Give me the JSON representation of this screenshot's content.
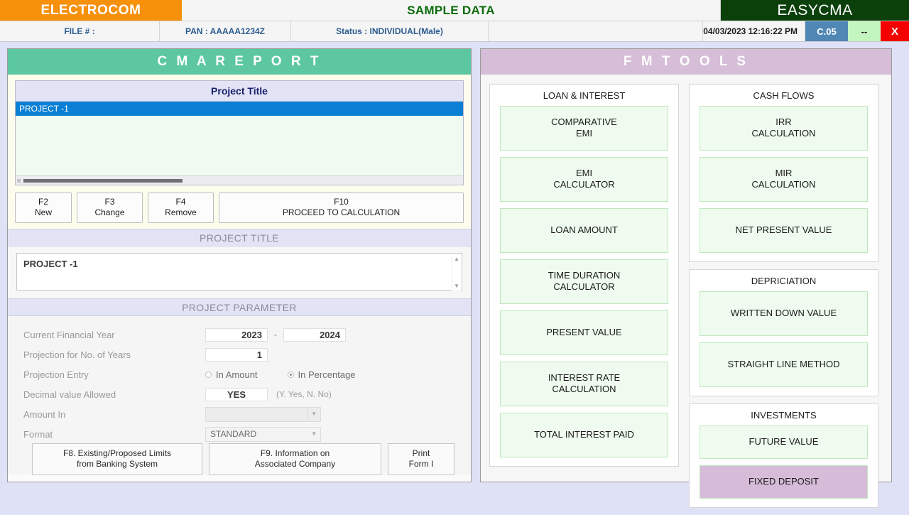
{
  "header": {
    "brand_left": "ELECTROCOM",
    "brand_mid": "SAMPLE DATA",
    "brand_right": "EASYCMA",
    "brand_left_color": "#f7900b",
    "brand_mid_color": "#0b6b0b",
    "brand_right_color": "#0b400b"
  },
  "statusbar": {
    "file": "FILE # :",
    "pan": "PAN : AAAAA1234Z",
    "status": "Status : INDIVIDUAL(Male)",
    "datetime": "04/03/2023 12:16:22 PM",
    "version": "C.05",
    "minimize": "--",
    "close": "X",
    "version_color": "#5087b5",
    "minimize_color": "#c3f5c0",
    "close_color": "#f50000"
  },
  "left_panel": {
    "title": "C M A   R E P O R T",
    "title_bg": "#5cc7a0",
    "list": {
      "column_header": "Project Title",
      "rows": [
        {
          "label": "PROJECT -1",
          "selected": true
        }
      ],
      "selected_bg": "#0a7fd4"
    },
    "fn_buttons": [
      {
        "key": "F2",
        "label": "New"
      },
      {
        "key": "F3",
        "label": "Change"
      },
      {
        "key": "F4",
        "label": "Remove"
      },
      {
        "key": "F10",
        "label": "PROCEED TO CALCULATION"
      }
    ],
    "project_title_band": "PROJECT TITLE",
    "project_title_value": "PROJECT -1",
    "project_parameter_band": "PROJECT PARAMETER",
    "parameters": {
      "financial_year_label": "Current Financial Year",
      "financial_year_from": "2023",
      "financial_year_dash": "-",
      "financial_year_to": "2024",
      "projection_years_label": "Projection for No. of Years",
      "projection_years_value": "1",
      "projection_entry_label": "Projection Entry",
      "projection_entry_option_amount": "In Amount",
      "projection_entry_option_percentage": "In Percentage",
      "projection_entry_selected": "In Percentage",
      "decimal_label": "Decimal value Allowed",
      "decimal_value": "YES",
      "decimal_hint": "(Y. Yes, N. No)",
      "amount_in_label": "Amount In",
      "amount_in_value": "",
      "format_label": "Format",
      "format_value": "STANDARD"
    },
    "bottom_buttons": [
      {
        "line1": "F8. Existing/Proposed Limits",
        "line2": "from Banking System"
      },
      {
        "line1": "F9. Information on",
        "line2": "Associated Company"
      },
      {
        "line1": "Print",
        "line2": "Form I"
      }
    ]
  },
  "right_panel": {
    "title": "F M   T O O L S",
    "title_bg": "#d6bdd8",
    "groups_left": [
      {
        "title": "LOAN & INTEREST",
        "buttons": [
          {
            "line1": "COMPARATIVE",
            "line2": "EMI",
            "selected": false
          },
          {
            "line1": "EMI",
            "line2": "CALCULATOR",
            "selected": false
          },
          {
            "line1": "LOAN AMOUNT",
            "line2": "",
            "selected": false
          },
          {
            "line1": "TIME DURATION",
            "line2": "CALCULATOR",
            "selected": false
          },
          {
            "line1": "PRESENT VALUE",
            "line2": "",
            "selected": false
          },
          {
            "line1": "INTEREST RATE",
            "line2": "CALCULATION",
            "selected": false
          },
          {
            "line1": "TOTAL INTEREST PAID",
            "line2": "",
            "selected": false
          }
        ]
      }
    ],
    "groups_right": [
      {
        "title": "CASH FLOWS",
        "buttons": [
          {
            "line1": "IRR",
            "line2": "CALCULATION",
            "selected": false
          },
          {
            "line1": "MIR",
            "line2": "CALCULATION",
            "selected": false
          },
          {
            "line1": "NET PRESENT VALUE",
            "line2": "",
            "selected": false
          }
        ]
      },
      {
        "title": "DEPRICIATION",
        "buttons": [
          {
            "line1": "WRITTEN DOWN VALUE",
            "line2": "",
            "selected": false
          },
          {
            "line1": "STRAIGHT LINE METHOD",
            "line2": "",
            "selected": false
          }
        ]
      },
      {
        "title": "INVESTMENTS",
        "buttons": [
          {
            "line1": "FUTURE VALUE",
            "line2": "",
            "selected": false
          },
          {
            "line1": "FIXED DEPOSIT",
            "line2": "",
            "selected": true
          }
        ]
      }
    ],
    "selected_bg": "#d7bcd9"
  }
}
